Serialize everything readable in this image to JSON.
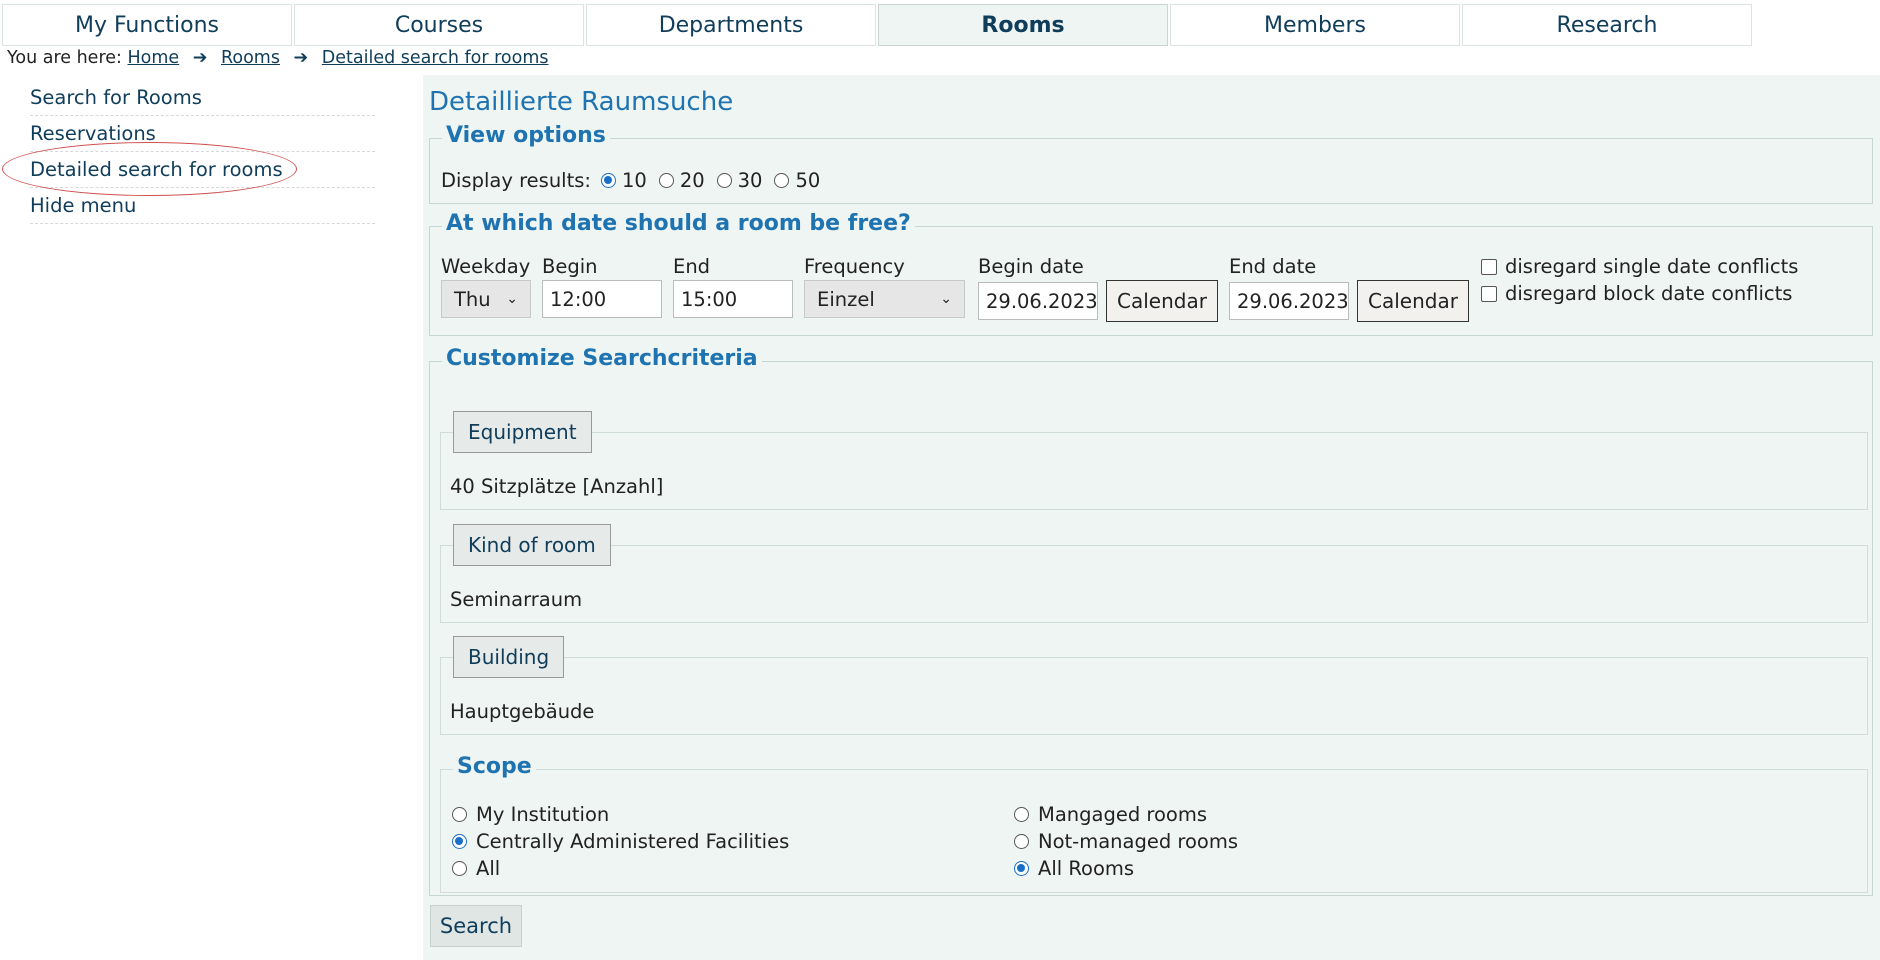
{
  "nav": {
    "tabs": [
      {
        "label": "My Functions"
      },
      {
        "label": "Courses"
      },
      {
        "label": "Departments"
      },
      {
        "label": "Rooms",
        "active": true
      },
      {
        "label": "Members"
      },
      {
        "label": "Research"
      }
    ]
  },
  "breadcrumb": {
    "prefix": "You are here:",
    "items": [
      "Home",
      "Rooms",
      "Detailed search for rooms"
    ]
  },
  "sidebar": {
    "items": [
      {
        "label": "Search for Rooms"
      },
      {
        "label": "Reservations"
      },
      {
        "label": "Detailed search for rooms",
        "highlighted": true
      },
      {
        "label": "Hide menu"
      }
    ]
  },
  "main": {
    "title": "Detaillierte Raumsuche",
    "view_options": {
      "legend": "View options",
      "label": "Display results:",
      "options": [
        "10",
        "20",
        "30",
        "50"
      ],
      "selected": "10"
    },
    "date": {
      "legend": "At which date should a room be free?",
      "weekday_label": "Weekday",
      "weekday_value": "Thu",
      "begin_label": "Begin",
      "begin_value": "12:00",
      "end_label": "End",
      "end_value": "15:00",
      "frequency_label": "Frequency",
      "frequency_value": "Einzel",
      "begin_date_label": "Begin date",
      "begin_date_value": "29.06.2023",
      "end_date_label": "End date",
      "end_date_value": "29.06.2023",
      "calendar_label": "Calendar",
      "disregard_single": "disregard single date conflicts",
      "disregard_block": "disregard block date conflicts"
    },
    "criteria": {
      "legend": "Customize Searchcriteria",
      "equipment": {
        "button": "Equipment",
        "value": "40 Sitzplätze [Anzahl]"
      },
      "kind_of_room": {
        "button": "Kind of room",
        "value": "Seminarraum"
      },
      "building": {
        "button": "Building",
        "value": "Hauptgebäude"
      },
      "scope": {
        "legend": "Scope",
        "left_options": [
          "My Institution",
          "Centrally Administered Facilities",
          "All"
        ],
        "left_selected": "Centrally Administered Facilities",
        "right_options": [
          "Mangaged rooms",
          "Not-managed rooms",
          "All Rooms"
        ],
        "right_selected": "All Rooms"
      }
    },
    "search_label": "Search"
  },
  "colors": {
    "accent": "#1e73b0",
    "nav_text": "#0f3d5a",
    "panel_bg": "#eef5f3",
    "highlight_circle": "#d05050"
  }
}
